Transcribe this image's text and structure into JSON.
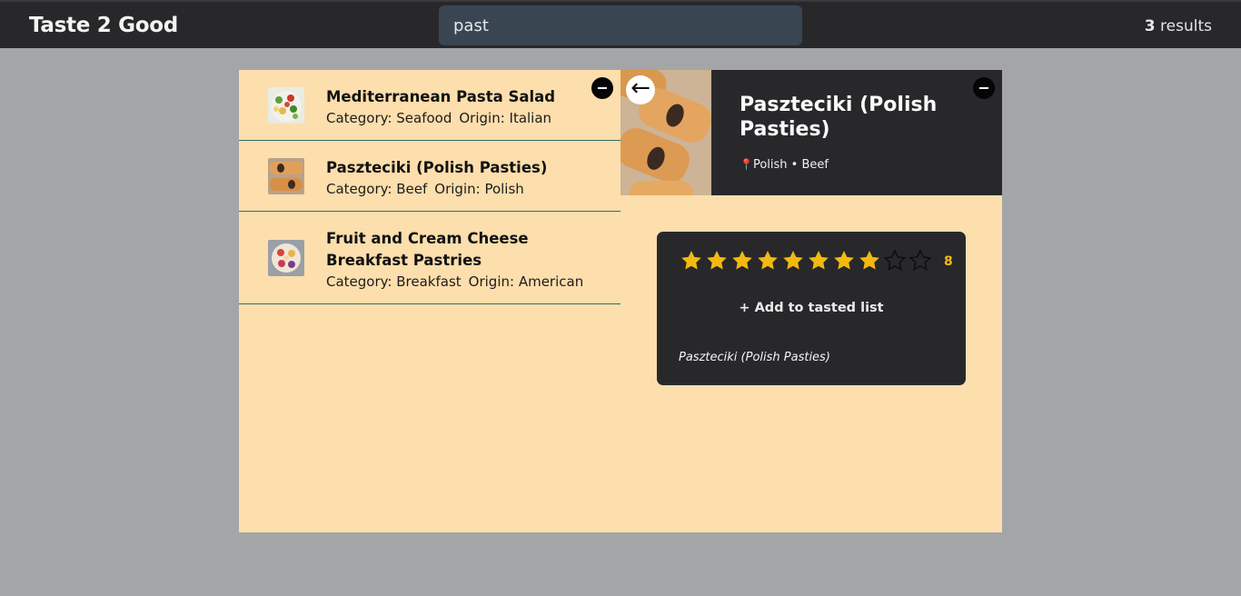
{
  "app": {
    "title": "Taste 2 Good"
  },
  "search": {
    "value": "past",
    "placeholder": ""
  },
  "results": {
    "count": "3",
    "label": "results"
  },
  "list": [
    {
      "title": "Mediterranean Pasta Salad",
      "category_label": "Category: Seafood",
      "origin_label": "Origin: Italian"
    },
    {
      "title": "Paszteciki (Polish Pasties)",
      "category_label": "Category: Beef",
      "origin_label": "Origin: Polish"
    },
    {
      "title": "Fruit and Cream Cheese Breakfast Pastries",
      "category_label": "Category: Breakfast",
      "origin_label": "Origin: American"
    }
  ],
  "detail": {
    "back_icon": "arrow-left-icon",
    "title": "Paszteciki (Polish Pasties)",
    "pin_icon": "📍",
    "origin": "Polish",
    "separator": "•",
    "category": "Beef",
    "rating": {
      "value": 8,
      "max": 10,
      "display": "8"
    },
    "add_label": "+ Add to tasted list",
    "name_caption": "Paszteciki (Polish Pasties)"
  },
  "colors": {
    "topbar": "#28282b",
    "search_bg": "#394652",
    "page_bg": "#a4a5a7",
    "panel_bg": "#fddead",
    "card_bg": "#28282b",
    "star_filled": "#f2b90f",
    "divider": "#2e6e66"
  }
}
